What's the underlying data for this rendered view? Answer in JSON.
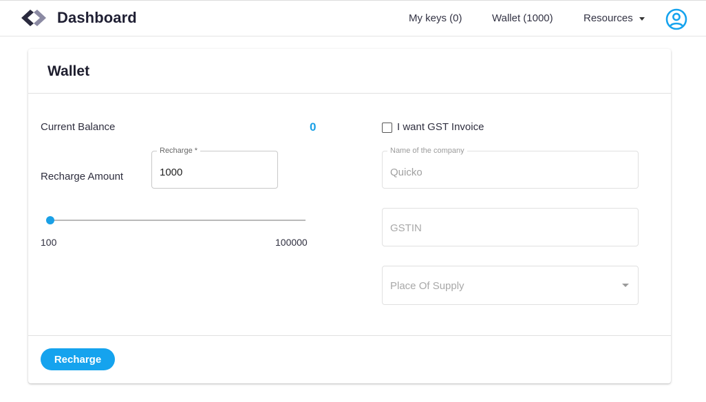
{
  "app": {
    "title": "Dashboard",
    "logo_icon": "code-brackets-icon"
  },
  "nav": {
    "my_keys": "My keys (0)",
    "wallet": "Wallet (1000)",
    "resources": "Resources",
    "account_icon": "account-circle-icon"
  },
  "card": {
    "title": "Wallet",
    "current_balance_label": "Current Balance",
    "current_balance_value": "0",
    "recharge_amount_label": "Recharge Amount",
    "recharge_field": {
      "label": "Recharge *",
      "value": "1000"
    },
    "slider": {
      "min_label": "100",
      "max_label": "100000",
      "min": 100,
      "max": 100000,
      "value": 1000
    },
    "gst_checkbox": {
      "label": "I want GST Invoice",
      "checked": false
    },
    "company_field": {
      "label": "Name of the company",
      "value": "Quicko",
      "disabled": true
    },
    "gstin_field": {
      "placeholder": "GSTIN",
      "disabled": true
    },
    "place_of_supply": {
      "placeholder": "Place Of Supply",
      "disabled": true
    },
    "recharge_button": "Recharge"
  },
  "colors": {
    "accent": "#1aa0e6",
    "button": "#15a3ee",
    "text": "#2b2b3b",
    "border": "#e0e0e0"
  }
}
